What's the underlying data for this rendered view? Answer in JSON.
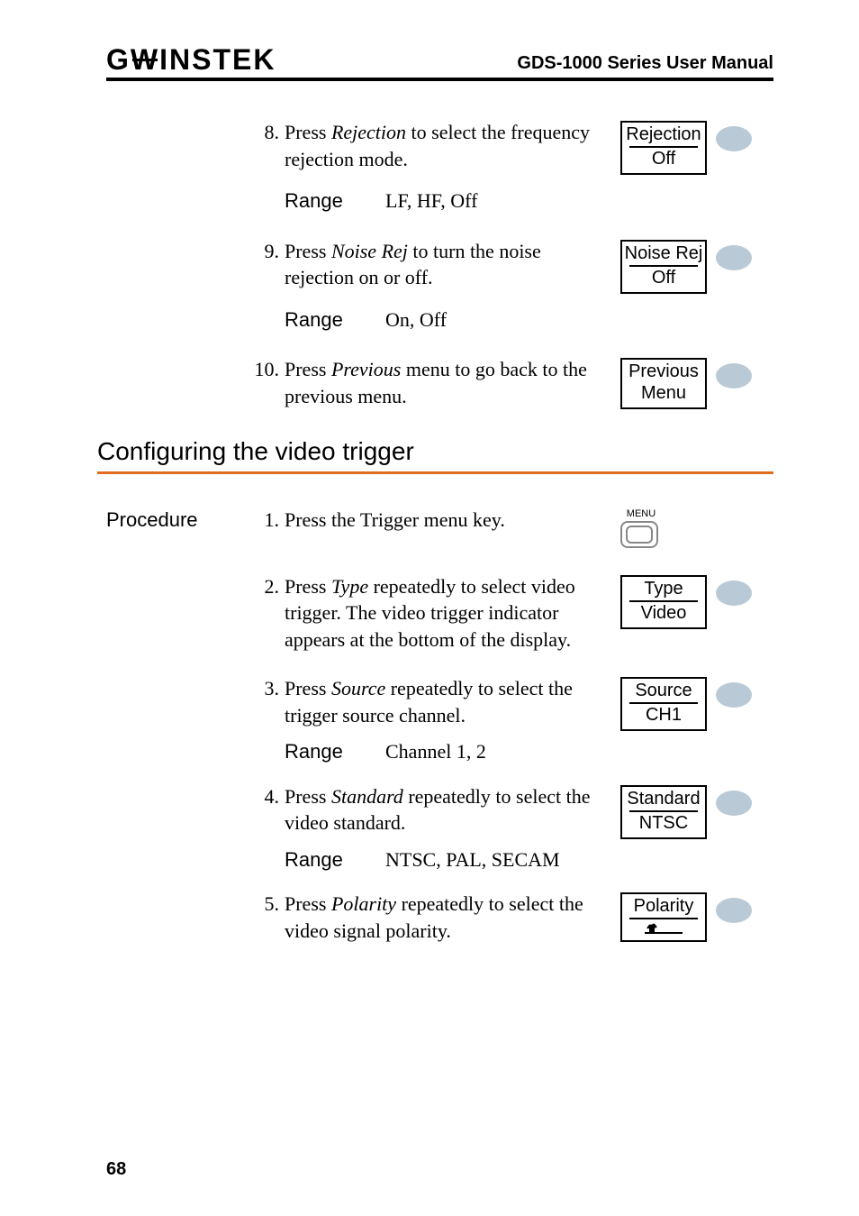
{
  "header": {
    "brand_g": "G",
    "brand_u": "W",
    "brand_rest": "INSTEK",
    "doc_title": "GDS-1000 Series User Manual"
  },
  "top_steps": [
    {
      "num": "8.",
      "text_pre": "Press ",
      "text_em": "Rejection",
      "text_post": " to select the frequency rejection mode.",
      "key_line1": "Rejection",
      "key_line2": "Off",
      "range_label": "Range",
      "range_value": "LF, HF, Off"
    },
    {
      "num": "9.",
      "text_pre": "Press ",
      "text_em": "Noise Rej",
      "text_post": " to turn the noise rejection on or off.",
      "key_line1": "Noise Rej",
      "key_line2": "Off",
      "range_label": "Range",
      "range_value": "On, Off"
    },
    {
      "num": "10.",
      "text_pre": "Press ",
      "text_em": "Previous",
      "text_post": " menu to go back to the previous menu.",
      "key_line1": "Previous",
      "key_line2": "Menu",
      "no_divider": true
    }
  ],
  "section_title": "Configuring the video trigger",
  "procedure_label": "Procedure",
  "proc_steps": [
    {
      "num": "1.",
      "text": "Press the Trigger menu key.",
      "menu_label": "MENU"
    },
    {
      "num": "2.",
      "text_pre": "Press ",
      "text_em": "Type",
      "text_post": " repeatedly to select video trigger. The video trigger indicator appears at the bottom of the display.",
      "key_line1": "Type",
      "key_line2": "Video"
    },
    {
      "num": "3.",
      "text_pre": "Press ",
      "text_em": "Source",
      "text_post": " repeatedly to select the trigger source channel.",
      "key_line1": "Source",
      "key_line2": "CH1",
      "range_label": "Range",
      "range_value": "Channel 1, 2"
    },
    {
      "num": "4.",
      "text_pre": "Press ",
      "text_em": "Standard",
      "text_post": " repeatedly to select the video standard.",
      "key_line1": "Standard",
      "key_line2": "NTSC",
      "range_label": "Range",
      "range_value": "NTSC, PAL, SECAM"
    },
    {
      "num": "5.",
      "text_pre": "Press ",
      "text_em": "Polarity",
      "text_post": " repeatedly to select the video signal polarity.",
      "key_line1": "Polarity",
      "polarity_icon": true
    }
  ],
  "page_number": "68"
}
